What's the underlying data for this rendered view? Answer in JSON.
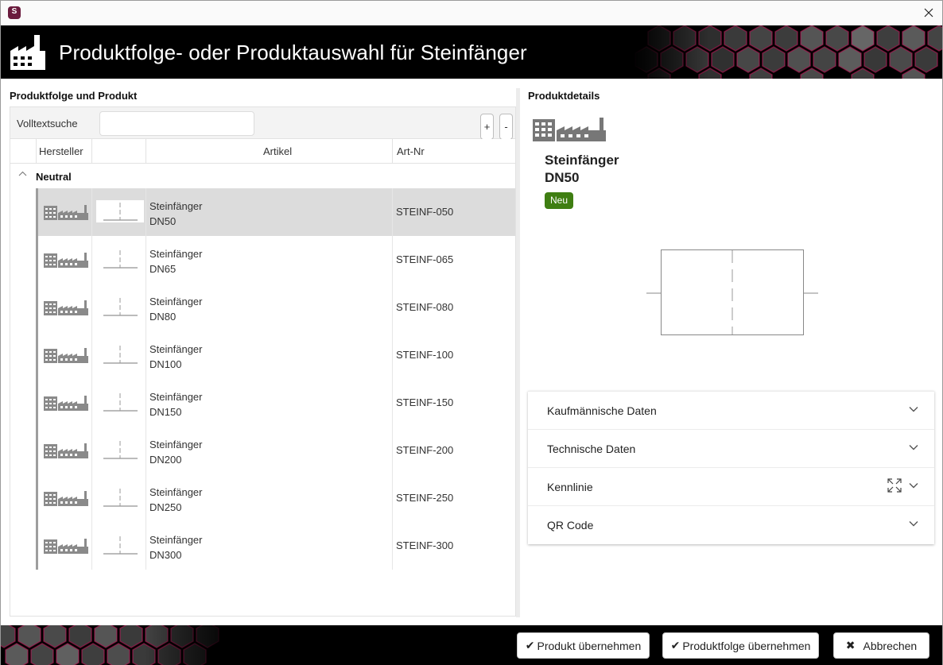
{
  "window": {
    "close_glyph": "✕"
  },
  "header": {
    "title": "Produktfolge- oder Produktauswahl für Steinfänger"
  },
  "left": {
    "section_title": "Produktfolge und Produkt",
    "search_label": "Volltextsuche",
    "search_value": "",
    "plus_label": "+",
    "minus_label": "-",
    "columns": [
      "Hersteller",
      "",
      "Artikel",
      "Art-Nr"
    ],
    "group_label": "Neutral",
    "rows": [
      {
        "name_line1": "Steinfänger",
        "name_line2": "DN50",
        "art_nr": "STEINF-050"
      },
      {
        "name_line1": "Steinfänger",
        "name_line2": "DN65",
        "art_nr": "STEINF-065"
      },
      {
        "name_line1": "Steinfänger",
        "name_line2": "DN80",
        "art_nr": "STEINF-080"
      },
      {
        "name_line1": "Steinfänger",
        "name_line2": "DN100",
        "art_nr": "STEINF-100"
      },
      {
        "name_line1": "Steinfänger",
        "name_line2": "DN150",
        "art_nr": "STEINF-150"
      },
      {
        "name_line1": "Steinfänger",
        "name_line2": "DN200",
        "art_nr": "STEINF-200"
      },
      {
        "name_line1": "Steinfänger",
        "name_line2": "DN250",
        "art_nr": "STEINF-250"
      },
      {
        "name_line1": "Steinfänger",
        "name_line2": "DN300",
        "art_nr": "STEINF-300"
      }
    ]
  },
  "right": {
    "section_title": "Produktdetails",
    "name_line1": "Steinfänger",
    "name_line2": "DN50",
    "badge": "Neu",
    "accordion": [
      "Kaufmännische Daten",
      "Technische Daten",
      "Kennlinie",
      "QR Code"
    ]
  },
  "footer": {
    "btn_product": "Produkt übernehmen",
    "btn_series": "Produktfolge übernehmen",
    "btn_cancel": "Abbrechen"
  },
  "colors": {
    "accent_badge": "#3f7e12",
    "selection": "#dcdcdc",
    "banner": "#000000",
    "hex_highlight": "#c2185b"
  }
}
